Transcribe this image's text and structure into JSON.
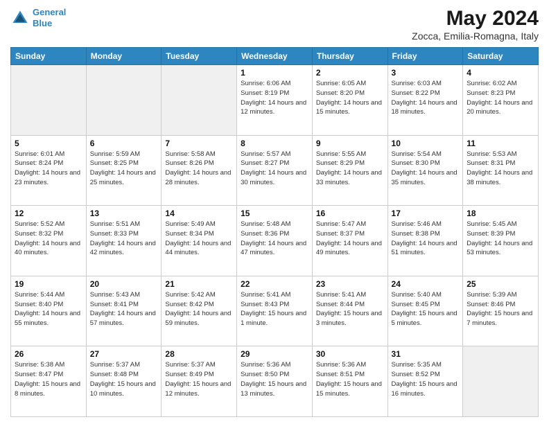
{
  "header": {
    "logo_line1": "General",
    "logo_line2": "Blue",
    "month": "May 2024",
    "location": "Zocca, Emilia-Romagna, Italy"
  },
  "days_of_week": [
    "Sunday",
    "Monday",
    "Tuesday",
    "Wednesday",
    "Thursday",
    "Friday",
    "Saturday"
  ],
  "weeks": [
    [
      {
        "day": "",
        "info": "",
        "empty": true
      },
      {
        "day": "",
        "info": "",
        "empty": true
      },
      {
        "day": "",
        "info": "",
        "empty": true
      },
      {
        "day": "1",
        "info": "Sunrise: 6:06 AM\nSunset: 8:19 PM\nDaylight: 14 hours\nand 12 minutes."
      },
      {
        "day": "2",
        "info": "Sunrise: 6:05 AM\nSunset: 8:20 PM\nDaylight: 14 hours\nand 15 minutes."
      },
      {
        "day": "3",
        "info": "Sunrise: 6:03 AM\nSunset: 8:22 PM\nDaylight: 14 hours\nand 18 minutes."
      },
      {
        "day": "4",
        "info": "Sunrise: 6:02 AM\nSunset: 8:23 PM\nDaylight: 14 hours\nand 20 minutes."
      }
    ],
    [
      {
        "day": "5",
        "info": "Sunrise: 6:01 AM\nSunset: 8:24 PM\nDaylight: 14 hours\nand 23 minutes."
      },
      {
        "day": "6",
        "info": "Sunrise: 5:59 AM\nSunset: 8:25 PM\nDaylight: 14 hours\nand 25 minutes."
      },
      {
        "day": "7",
        "info": "Sunrise: 5:58 AM\nSunset: 8:26 PM\nDaylight: 14 hours\nand 28 minutes."
      },
      {
        "day": "8",
        "info": "Sunrise: 5:57 AM\nSunset: 8:27 PM\nDaylight: 14 hours\nand 30 minutes."
      },
      {
        "day": "9",
        "info": "Sunrise: 5:55 AM\nSunset: 8:29 PM\nDaylight: 14 hours\nand 33 minutes."
      },
      {
        "day": "10",
        "info": "Sunrise: 5:54 AM\nSunset: 8:30 PM\nDaylight: 14 hours\nand 35 minutes."
      },
      {
        "day": "11",
        "info": "Sunrise: 5:53 AM\nSunset: 8:31 PM\nDaylight: 14 hours\nand 38 minutes."
      }
    ],
    [
      {
        "day": "12",
        "info": "Sunrise: 5:52 AM\nSunset: 8:32 PM\nDaylight: 14 hours\nand 40 minutes."
      },
      {
        "day": "13",
        "info": "Sunrise: 5:51 AM\nSunset: 8:33 PM\nDaylight: 14 hours\nand 42 minutes."
      },
      {
        "day": "14",
        "info": "Sunrise: 5:49 AM\nSunset: 8:34 PM\nDaylight: 14 hours\nand 44 minutes."
      },
      {
        "day": "15",
        "info": "Sunrise: 5:48 AM\nSunset: 8:36 PM\nDaylight: 14 hours\nand 47 minutes."
      },
      {
        "day": "16",
        "info": "Sunrise: 5:47 AM\nSunset: 8:37 PM\nDaylight: 14 hours\nand 49 minutes."
      },
      {
        "day": "17",
        "info": "Sunrise: 5:46 AM\nSunset: 8:38 PM\nDaylight: 14 hours\nand 51 minutes."
      },
      {
        "day": "18",
        "info": "Sunrise: 5:45 AM\nSunset: 8:39 PM\nDaylight: 14 hours\nand 53 minutes."
      }
    ],
    [
      {
        "day": "19",
        "info": "Sunrise: 5:44 AM\nSunset: 8:40 PM\nDaylight: 14 hours\nand 55 minutes."
      },
      {
        "day": "20",
        "info": "Sunrise: 5:43 AM\nSunset: 8:41 PM\nDaylight: 14 hours\nand 57 minutes."
      },
      {
        "day": "21",
        "info": "Sunrise: 5:42 AM\nSunset: 8:42 PM\nDaylight: 14 hours\nand 59 minutes."
      },
      {
        "day": "22",
        "info": "Sunrise: 5:41 AM\nSunset: 8:43 PM\nDaylight: 15 hours\nand 1 minute."
      },
      {
        "day": "23",
        "info": "Sunrise: 5:41 AM\nSunset: 8:44 PM\nDaylight: 15 hours\nand 3 minutes."
      },
      {
        "day": "24",
        "info": "Sunrise: 5:40 AM\nSunset: 8:45 PM\nDaylight: 15 hours\nand 5 minutes."
      },
      {
        "day": "25",
        "info": "Sunrise: 5:39 AM\nSunset: 8:46 PM\nDaylight: 15 hours\nand 7 minutes."
      }
    ],
    [
      {
        "day": "26",
        "info": "Sunrise: 5:38 AM\nSunset: 8:47 PM\nDaylight: 15 hours\nand 8 minutes."
      },
      {
        "day": "27",
        "info": "Sunrise: 5:37 AM\nSunset: 8:48 PM\nDaylight: 15 hours\nand 10 minutes."
      },
      {
        "day": "28",
        "info": "Sunrise: 5:37 AM\nSunset: 8:49 PM\nDaylight: 15 hours\nand 12 minutes."
      },
      {
        "day": "29",
        "info": "Sunrise: 5:36 AM\nSunset: 8:50 PM\nDaylight: 15 hours\nand 13 minutes."
      },
      {
        "day": "30",
        "info": "Sunrise: 5:36 AM\nSunset: 8:51 PM\nDaylight: 15 hours\nand 15 minutes."
      },
      {
        "day": "31",
        "info": "Sunrise: 5:35 AM\nSunset: 8:52 PM\nDaylight: 15 hours\nand 16 minutes."
      },
      {
        "day": "",
        "info": "",
        "empty": true
      }
    ]
  ]
}
